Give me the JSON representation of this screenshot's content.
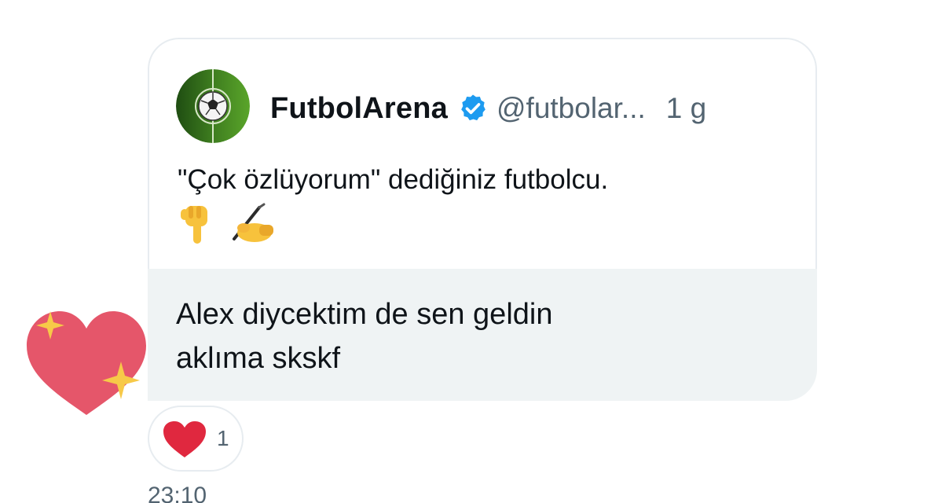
{
  "quoted_tweet": {
    "author_name": "FutbolArena",
    "handle": "@futbolar...",
    "time_ago": "1 g",
    "text": "\"Çok özlüyorum\" dediğiniz futbolcu.",
    "emojis": [
      "pointing-down-icon",
      "writing-hand-icon"
    ],
    "avatar_icon": "soccer-ball-icon",
    "verified": true
  },
  "message": {
    "line1": "Alex diycektim de sen geldin",
    "line2": "aklıma skskf"
  },
  "side_reaction": {
    "icon": "sparkling-heart-icon"
  },
  "reaction": {
    "icon": "heart-icon",
    "count": "1"
  },
  "timestamp": "23:10",
  "colors": {
    "text_primary": "#0f1419",
    "text_secondary": "#536471",
    "verified_blue": "#1d9bf0",
    "bubble_bg": "#eff3f4",
    "border": "#e7ecf0",
    "heart_red": "#e0283f"
  }
}
